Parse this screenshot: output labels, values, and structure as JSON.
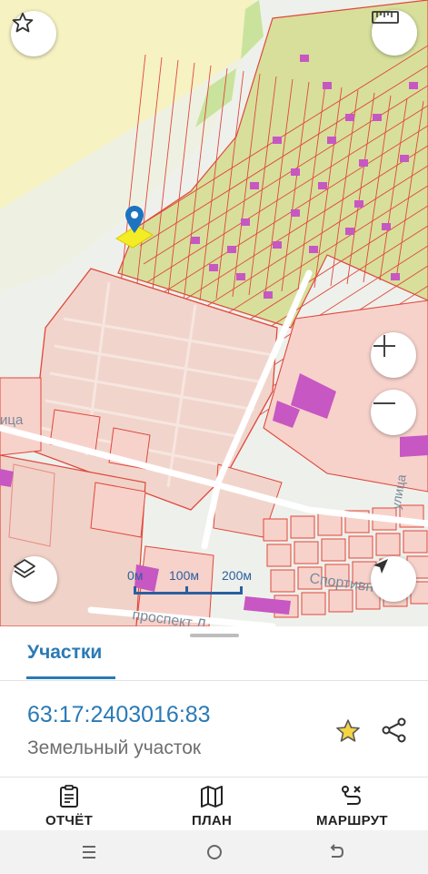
{
  "map": {
    "scale_labels": [
      "0м",
      "100м",
      "200м"
    ],
    "street_labels": [
      "Спортивная",
      "проспект Л",
      "ица",
      "улица"
    ],
    "colors": {
      "parcel_fill": "#f7d2cb",
      "parcel_border": "#e0473a",
      "allotment_fill": "#d7df9b",
      "building": "#c757c2",
      "selected": "#f4ec25",
      "marker": "#1d73c0",
      "park": "#f6f2c2"
    },
    "buttons": {
      "favorite": "star-outline-icon",
      "ruler": "ruler-icon",
      "zoom_in": "plus-icon",
      "zoom_out": "minus-icon",
      "layers": "layers-icon",
      "location": "navigation-arrow-icon"
    }
  },
  "sheet": {
    "tab_label": "Участки",
    "cadastral_number": "63:17:2403016:83",
    "object_type": "Земельный участок"
  },
  "actions": [
    {
      "label": "ОТЧЁТ",
      "icon": "report-clipboard-icon"
    },
    {
      "label": "ПЛАН",
      "icon": "map-plan-icon"
    },
    {
      "label": "МАРШРУТ",
      "icon": "route-icon"
    }
  ],
  "navbar": {
    "icons": [
      "menu-icon",
      "home-circle-icon",
      "back-icon"
    ]
  }
}
